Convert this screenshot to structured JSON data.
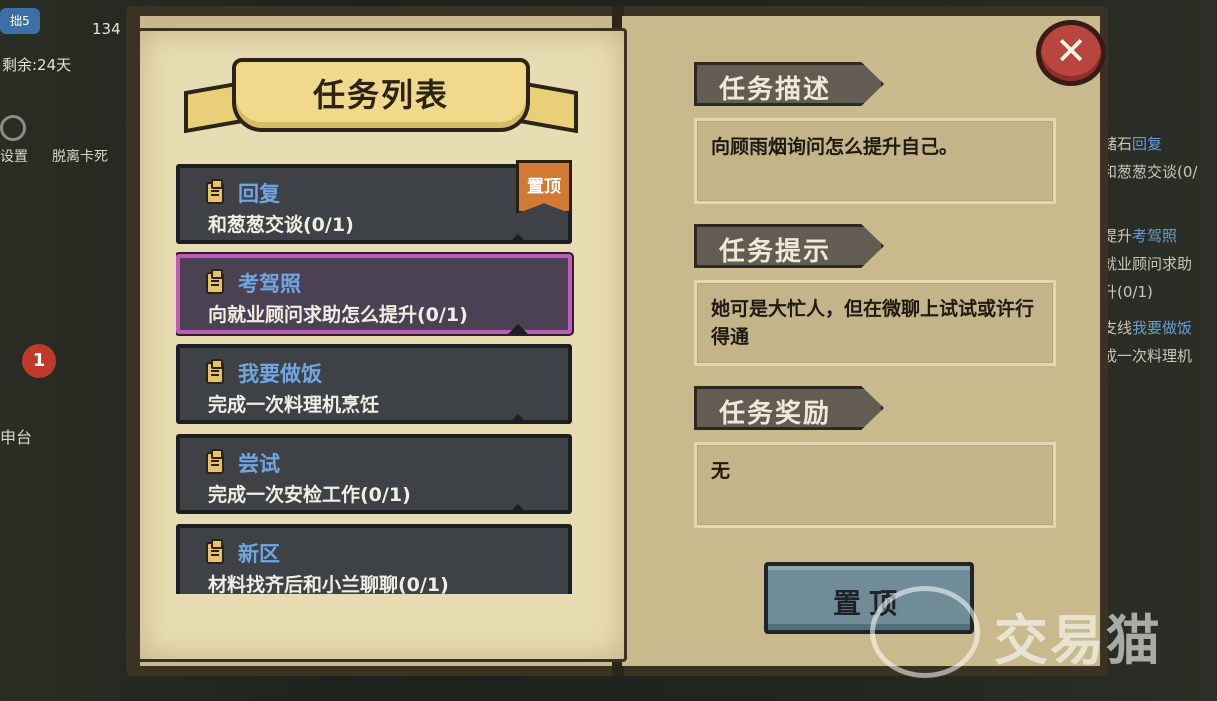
{
  "background": {
    "days_remaining": "剩余:24天",
    "coin_count": "134",
    "top_badge": "拙5",
    "settings_label": "设置",
    "stuck_label": "脱离卡死",
    "notification_count": "1",
    "front_desk_label": "申台",
    "right_log": [
      {
        "text": "储石",
        "highlight": "回复"
      },
      {
        "text": "和葱葱交谈(0/"
      },
      {
        "text": "提升",
        "highlight": "考驾照"
      },
      {
        "text": "就业顾问求助"
      },
      {
        "text": "升(0/1)"
      },
      {
        "text": "支线",
        "highlight": "我要做饭"
      },
      {
        "text": "成一次料理机"
      }
    ]
  },
  "panel": {
    "title": "任务列表",
    "pin_tag": "置顶",
    "close_icon": "close-x-icon",
    "quests": [
      {
        "title": "回复",
        "desc": "和葱葱交谈(0/1)",
        "pinned": true,
        "selected": false
      },
      {
        "title": "考驾照",
        "desc": "向就业顾问求助怎么提升(0/1)",
        "pinned": false,
        "selected": true
      },
      {
        "title": "我要做饭",
        "desc": "完成一次料理机烹饪",
        "pinned": false,
        "selected": false
      },
      {
        "title": "尝试",
        "desc": "完成一次安检工作(0/1)",
        "pinned": false,
        "selected": false
      },
      {
        "title": "新区",
        "desc": "材料找齐后和小兰聊聊(0/1)",
        "pinned": false,
        "selected": false
      }
    ]
  },
  "detail": {
    "description_header": "任务描述",
    "description": "向顾雨烟询问怎么提升自己。",
    "hint_header": "任务提示",
    "hint": "她可是大忙人，但在微聊上试试或许行得通",
    "reward_header": "任务奖励",
    "reward": "无",
    "pin_button": "置顶"
  },
  "watermark": {
    "text": "交易猫"
  },
  "colors": {
    "quest_title": "#6fa6e0",
    "selected_border": "#c15bb8",
    "pin_tag": "#d27a33",
    "close_button": "#b8463f",
    "pin_button": "#6f8c98"
  }
}
